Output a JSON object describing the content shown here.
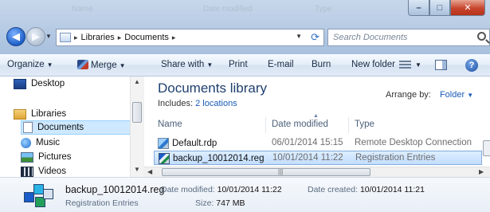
{
  "window": {
    "ghost_headers": [
      "Name",
      "Date modified",
      "Type"
    ],
    "controls": {
      "minimize": "–",
      "maximize": "□",
      "close": "✕"
    }
  },
  "address_bar": {
    "separator": "▸",
    "crumbs": [
      "Libraries",
      "Documents"
    ],
    "search_placeholder": "Search Documents"
  },
  "toolbar": {
    "organize": "Organize",
    "merge": "Merge",
    "share_with": "Share with",
    "print": "Print",
    "email": "E-mail",
    "burn": "Burn",
    "new_folder": "New folder"
  },
  "nav_pane": {
    "items": [
      {
        "label": "Desktop",
        "icon": "desktop-icon"
      },
      {
        "label": "Libraries",
        "icon": "libraries-icon"
      },
      {
        "label": "Documents",
        "icon": "documents-icon",
        "selected": true
      },
      {
        "label": "Music",
        "icon": "music-icon"
      },
      {
        "label": "Pictures",
        "icon": "pictures-icon"
      },
      {
        "label": "Videos",
        "icon": "videos-icon"
      }
    ]
  },
  "library": {
    "title": "Documents library",
    "includes_label": "Includes:",
    "includes_link": "2 locations",
    "arrange_label": "Arrange by:",
    "arrange_value": "Folder"
  },
  "columns": {
    "name": "Name",
    "date": "Date modified",
    "type": "Type"
  },
  "files": [
    {
      "name": "Default.rdp",
      "date": "06/01/2014 15:15",
      "type": "Remote Desktop Connection",
      "icon": "rdp-file-icon",
      "selected": false
    },
    {
      "name": "backup_10012014.reg",
      "date": "10/01/2014 11:22",
      "type": "Registration Entries",
      "icon": "reg-file-icon",
      "selected": true
    }
  ],
  "details": {
    "name": "backup_10012014.reg",
    "type": "Registration Entries",
    "date_modified_label": "Date modified:",
    "date_modified": "10/01/2014 11:22",
    "date_created_label": "Date created:",
    "date_created": "10/01/2014 11:21",
    "size_label": "Size:",
    "size": "747 MB"
  }
}
